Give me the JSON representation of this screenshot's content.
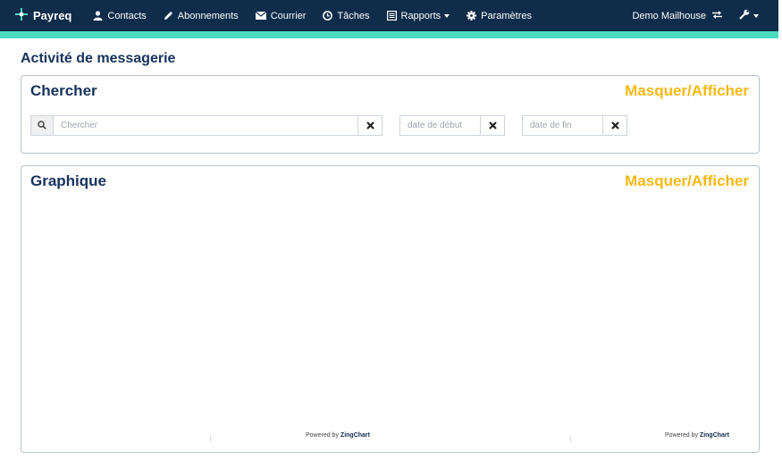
{
  "navbar": {
    "brand": "Payreq",
    "items": [
      {
        "label": "Contacts",
        "icon": "user-icon"
      },
      {
        "label": "Abonnements",
        "icon": "pencil-icon"
      },
      {
        "label": "Courrier",
        "icon": "envelope-icon"
      },
      {
        "label": "Tâches",
        "icon": "clock-icon"
      },
      {
        "label": "Rapports",
        "icon": "report-icon"
      },
      {
        "label": "Paramètres",
        "icon": "gear-icon"
      }
    ],
    "user": "Demo Mailhouse",
    "colors": {
      "background": "#0f2c4a",
      "accent": "#4ddbbf"
    }
  },
  "page": {
    "title": "Activité de messagerie"
  },
  "search_panel": {
    "title": "Chercher",
    "toggle": "Masquer/Afficher",
    "search_placeholder": "Chercher",
    "start_placeholder": "date de début",
    "end_placeholder": "date de fin"
  },
  "chart_panel": {
    "title": "Graphique",
    "toggle": "Masquer/Afficher",
    "powered_prefix": "Powered by",
    "powered_brand": "ZingChart"
  },
  "toggle_color": "#f6b913"
}
